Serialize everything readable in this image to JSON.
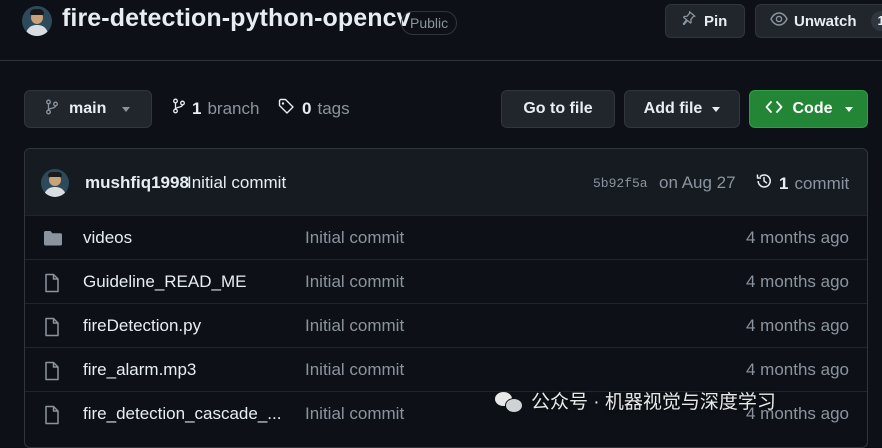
{
  "header": {
    "repo_name": "fire-detection-python-opencv",
    "visibility": "Public",
    "pin_label": "Pin",
    "watch_label": "Unwatch",
    "watch_count": "1"
  },
  "toolbar": {
    "branch_name": "main",
    "branch_count": "1",
    "branch_word": "branch",
    "tag_count": "0",
    "tag_word": "tags",
    "goto_file_label": "Go to file",
    "add_file_label": "Add file",
    "code_label": "Code"
  },
  "latest_commit": {
    "author": "mushfiq1998",
    "message": "Initial commit",
    "sha": "5b92f5a",
    "date": "on Aug 27",
    "count": "1",
    "count_word": "commit"
  },
  "files": [
    {
      "name": "videos",
      "type": "folder",
      "message": "Initial commit",
      "age": "4 months ago"
    },
    {
      "name": "Guideline_READ_ME",
      "type": "file",
      "message": "Initial commit",
      "age": "4 months ago"
    },
    {
      "name": "fireDetection.py",
      "type": "file",
      "message": "Initial commit",
      "age": "4 months ago"
    },
    {
      "name": "fire_alarm.mp3",
      "type": "file",
      "message": "Initial commit",
      "age": "4 months ago"
    },
    {
      "name": "fire_detection_cascade_...",
      "type": "file",
      "message": "Initial commit",
      "age": "4 months ago"
    }
  ],
  "watermark": {
    "text": "公众号 · 机器视觉与深度学习",
    "icon": "wechat-icon"
  },
  "colors": {
    "background": "#0d1117",
    "border": "#30363d",
    "code_button": "#238636",
    "muted_text": "#8b949e",
    "primary_text": "#e6edf3"
  }
}
